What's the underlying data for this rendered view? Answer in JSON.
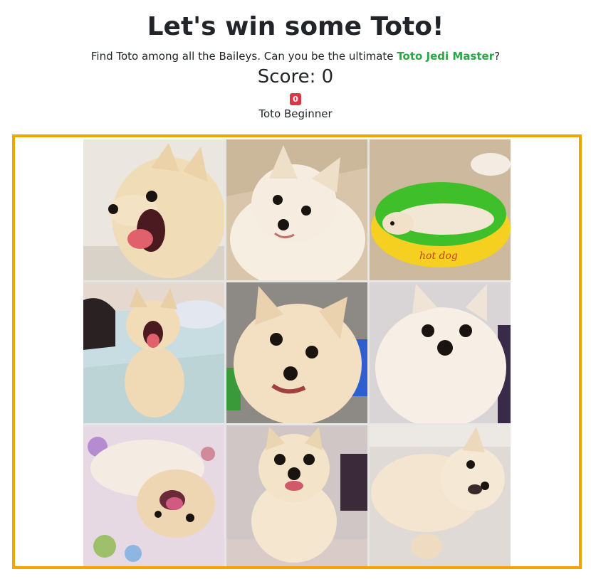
{
  "header": {
    "title": "Let's win some Toto!",
    "subtitle_prefix": "Find Toto among all the Baileys. Can you be the ultimate ",
    "subtitle_accent": "Toto Jedi Master",
    "subtitle_suffix": "?",
    "score_label": "Score: 0",
    "badge_count": "0",
    "rank": "Toto Beginner"
  },
  "colors": {
    "accent_green": "#28a745",
    "badge_red": "#dc3545",
    "board_border": "#f5a300"
  },
  "grid": {
    "tiles": [
      {
        "name": "tile-1",
        "scene": "pom-open-mouth-profile",
        "bg": "#e9e4de",
        "fur": "#f1dcb8"
      },
      {
        "name": "tile-2",
        "scene": "pom-head-tilt",
        "bg": "#d9c7ad",
        "fur": "#f6ece0"
      },
      {
        "name": "tile-3",
        "scene": "pom-hotdog-bed",
        "bg": "#cbb79c",
        "fur": "#f2e6d4"
      },
      {
        "name": "tile-4",
        "scene": "pom-sitting-bed",
        "bg": "#c9dce0",
        "fur": "#f0d9b5"
      },
      {
        "name": "tile-5",
        "scene": "pom-closeup-smile",
        "bg": "#8e8a86",
        "fur": "#f3e0c2"
      },
      {
        "name": "tile-6",
        "scene": "pom-fluffy-white",
        "bg": "#d8d4d6",
        "fur": "#f7efe6"
      },
      {
        "name": "tile-7",
        "scene": "pom-upside-down-blanket",
        "bg": "#d6c9d9",
        "fur": "#efd6b3"
      },
      {
        "name": "tile-8",
        "scene": "pom-standing-front",
        "bg": "#cfc7c6",
        "fur": "#f5e6cf"
      },
      {
        "name": "tile-9",
        "scene": "pom-lying-side",
        "bg": "#ded9d6",
        "fur": "#f3e5cf"
      }
    ]
  }
}
